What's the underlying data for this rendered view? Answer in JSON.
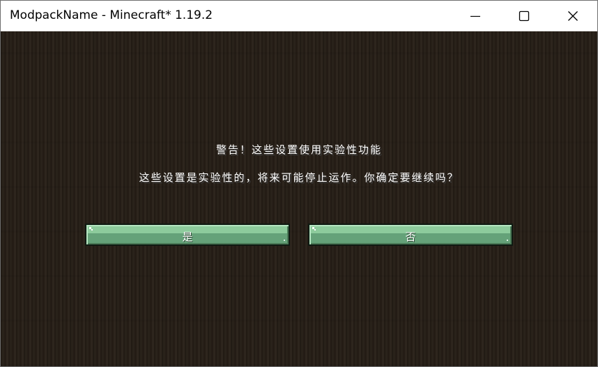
{
  "window": {
    "title": "ModpackName - Minecraft* 1.19.2",
    "controls": {
      "minimize": "minimize-icon",
      "maximize": "maximize-icon",
      "close": "close-icon"
    }
  },
  "dialog": {
    "title": "警告！这些设置使用实验性功能",
    "message": "这些设置是实验性的，将来可能停止运作。你确定要继续吗？",
    "yes_label": "是",
    "no_label": "否"
  },
  "colors": {
    "background": "#261e16",
    "button_top": "#8dcb9c",
    "button_bottom": "#65a279",
    "text": "#ffffff"
  }
}
